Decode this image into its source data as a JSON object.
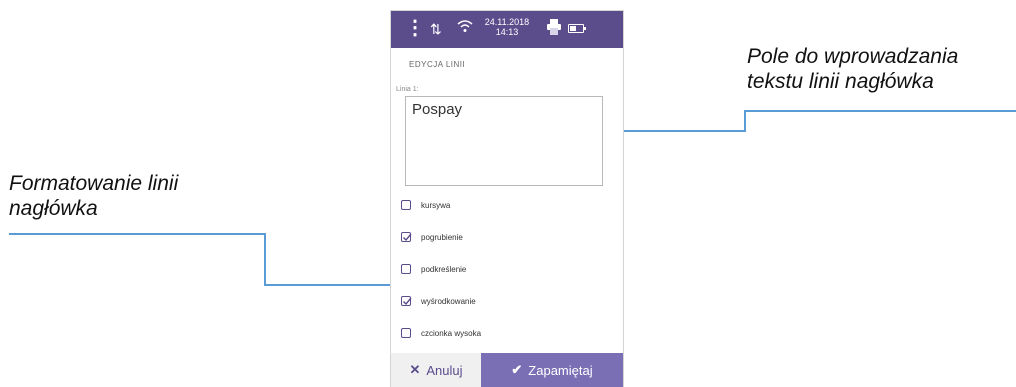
{
  "callouts": {
    "right": {
      "line1": "Pole do wprowadzania",
      "line2": "tekstu linii nagłówka"
    },
    "left": {
      "line1": "Formatowanie linii",
      "line2": "nagłówka"
    }
  },
  "colors": {
    "accent": "#5b4c8c",
    "save_button": "#7a6fb5",
    "connector": "#5b9bd5"
  },
  "status_bar": {
    "menu_icon": "more-vertical-icon",
    "date": "24.11.2018",
    "time": "14:13"
  },
  "screen_title": "EDYCJA LINII",
  "field": {
    "label": "Linia 1:",
    "value": "Pospay"
  },
  "options": [
    {
      "label": "kursywa",
      "checked": false
    },
    {
      "label": "pogrubienie",
      "checked": true
    },
    {
      "label": "podkreślenie",
      "checked": false
    },
    {
      "label": "wyśrodkowanie",
      "checked": true
    },
    {
      "label": "czcionka wysoka",
      "checked": false
    }
  ],
  "buttons": {
    "cancel": "Anuluj",
    "save": "Zapamiętaj"
  }
}
